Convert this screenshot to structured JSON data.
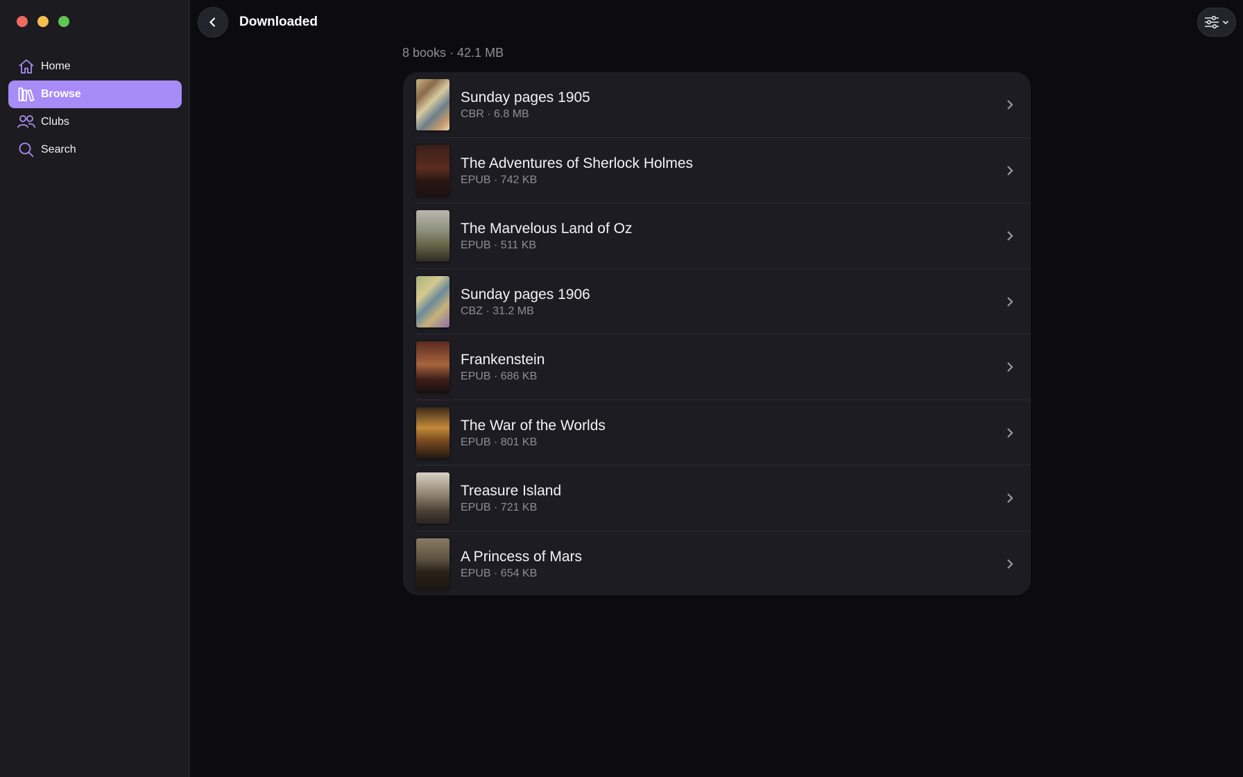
{
  "header": {
    "title": "Downloaded"
  },
  "sidebar": {
    "items": [
      {
        "label": "Home",
        "icon": "house-icon"
      },
      {
        "label": "Browse",
        "icon": "library-icon",
        "active": true
      },
      {
        "label": "Clubs",
        "icon": "people-icon"
      },
      {
        "label": "Search",
        "icon": "magnifier-icon"
      }
    ]
  },
  "summary": "8 books · 42.1 MB",
  "books": [
    {
      "title": "Sunday pages 1905",
      "meta": "CBR · 6.8 MB"
    },
    {
      "title": "The Adventures of Sherlock Holmes",
      "meta": "EPUB · 742 KB"
    },
    {
      "title": "The Marvelous Land of Oz",
      "meta": "EPUB · 511 KB"
    },
    {
      "title": "Sunday pages 1906",
      "meta": "CBZ · 31.2 MB"
    },
    {
      "title": "Frankenstein",
      "meta": "EPUB · 686 KB"
    },
    {
      "title": "The War of the Worlds",
      "meta": "EPUB · 801 KB"
    },
    {
      "title": "Treasure Island",
      "meta": "EPUB · 721 KB"
    },
    {
      "title": "A Princess of Mars",
      "meta": "EPUB · 654 KB"
    }
  ],
  "colors": {
    "accent": "#a78bf7",
    "sidebar_bg": "#1b1b20",
    "content_bg": "#0b0b10",
    "list_bg": "#1c1c22"
  }
}
